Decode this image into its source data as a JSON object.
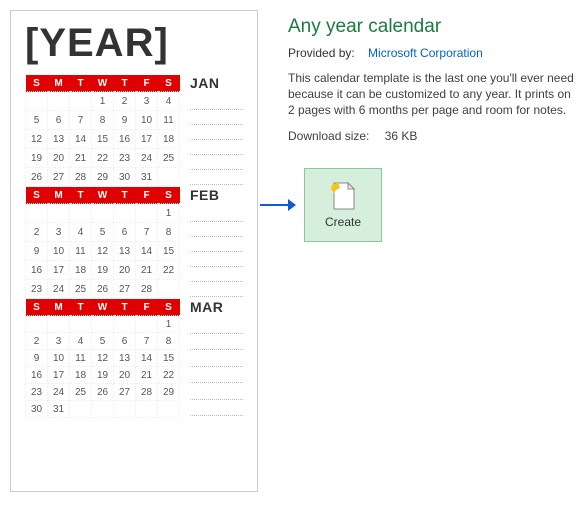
{
  "preview": {
    "year_placeholder": "[YEAR]",
    "day_headers": [
      "S",
      "M",
      "T",
      "W",
      "T",
      "F",
      "S"
    ],
    "months": [
      {
        "name": "JAN",
        "weeks": [
          [
            "",
            "",
            "",
            "1",
            "2",
            "3",
            "4"
          ],
          [
            "5",
            "6",
            "7",
            "8",
            "9",
            "10",
            "11"
          ],
          [
            "12",
            "13",
            "14",
            "15",
            "16",
            "17",
            "18"
          ],
          [
            "19",
            "20",
            "21",
            "22",
            "23",
            "24",
            "25"
          ],
          [
            "26",
            "27",
            "28",
            "29",
            "30",
            "31",
            ""
          ]
        ]
      },
      {
        "name": "FEB",
        "weeks": [
          [
            "",
            "",
            "",
            "",
            "",
            "",
            "1"
          ],
          [
            "2",
            "3",
            "4",
            "5",
            "6",
            "7",
            "8"
          ],
          [
            "9",
            "10",
            "11",
            "12",
            "13",
            "14",
            "15"
          ],
          [
            "16",
            "17",
            "18",
            "19",
            "20",
            "21",
            "22"
          ],
          [
            "23",
            "24",
            "25",
            "26",
            "27",
            "28",
            ""
          ]
        ]
      },
      {
        "name": "MAR",
        "weeks": [
          [
            "",
            "",
            "",
            "",
            "",
            "",
            "1"
          ],
          [
            "2",
            "3",
            "4",
            "5",
            "6",
            "7",
            "8"
          ],
          [
            "9",
            "10",
            "11",
            "12",
            "13",
            "14",
            "15"
          ],
          [
            "16",
            "17",
            "18",
            "19",
            "20",
            "21",
            "22"
          ],
          [
            "23",
            "24",
            "25",
            "26",
            "27",
            "28",
            "29"
          ],
          [
            "30",
            "31",
            "",
            "",
            "",
            "",
            ""
          ]
        ]
      }
    ]
  },
  "info": {
    "title": "Any year calendar",
    "provided_by_label": "Provided by:",
    "provider": "Microsoft Corporation",
    "description": "This calendar template is the last one you'll ever need because it can be customized to any year. It prints on 2 pages with 6 months per page and room for notes.",
    "download_size_label": "Download size:",
    "download_size": "36 KB",
    "create_label": "Create"
  }
}
